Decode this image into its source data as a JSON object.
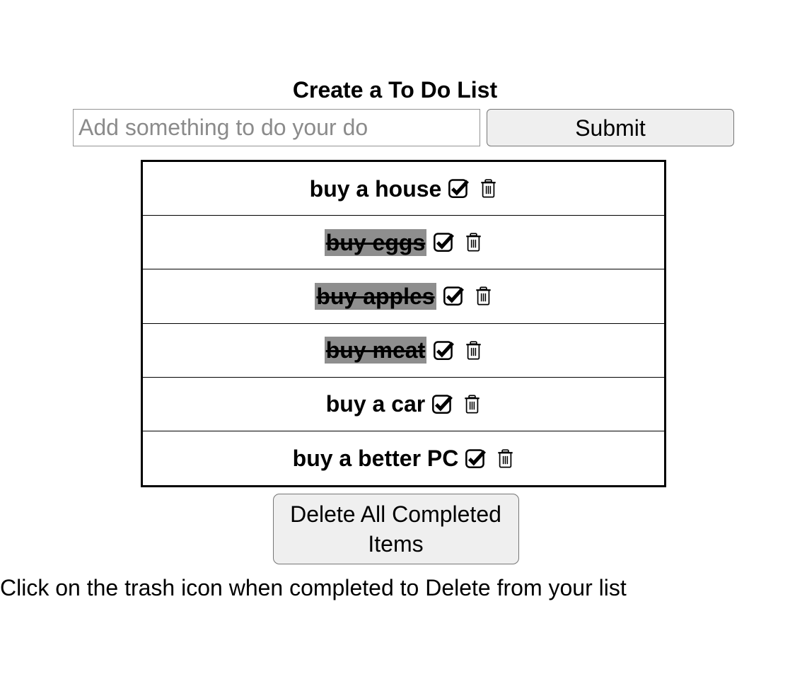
{
  "header": {
    "title": "Create a To Do List"
  },
  "form": {
    "input": {
      "value": "",
      "placeholder": "Add something to do your do"
    },
    "submit_label": "Submit"
  },
  "list": {
    "items": [
      {
        "label": "buy a house",
        "completed": false,
        "check_icon": "checkbox-checked-icon",
        "delete_icon": "trash-icon"
      },
      {
        "label": "buy eggs",
        "completed": true,
        "check_icon": "checkbox-checked-icon",
        "delete_icon": "trash-icon"
      },
      {
        "label": "buy apples",
        "completed": true,
        "check_icon": "checkbox-checked-icon",
        "delete_icon": "trash-icon"
      },
      {
        "label": "buy meat",
        "completed": true,
        "check_icon": "checkbox-checked-icon",
        "delete_icon": "trash-icon"
      },
      {
        "label": "buy a car",
        "completed": false,
        "check_icon": "checkbox-checked-icon",
        "delete_icon": "trash-icon"
      },
      {
        "label": "buy a better PC",
        "completed": false,
        "check_icon": "checkbox-checked-icon",
        "delete_icon": "trash-icon"
      }
    ]
  },
  "actions": {
    "delete_all_label": "Delete All Completed Items"
  },
  "footer": {
    "hint": "Click on the trash icon when completed to Delete from your list"
  },
  "colors": {
    "page_background": "#ffffff",
    "text": "#000000",
    "placeholder": "#8b8b8b",
    "button_background": "#efefef",
    "button_border": "#767676",
    "input_border": "#949494",
    "list_border": "#000000",
    "completed_highlight": "#8e8e8e"
  }
}
